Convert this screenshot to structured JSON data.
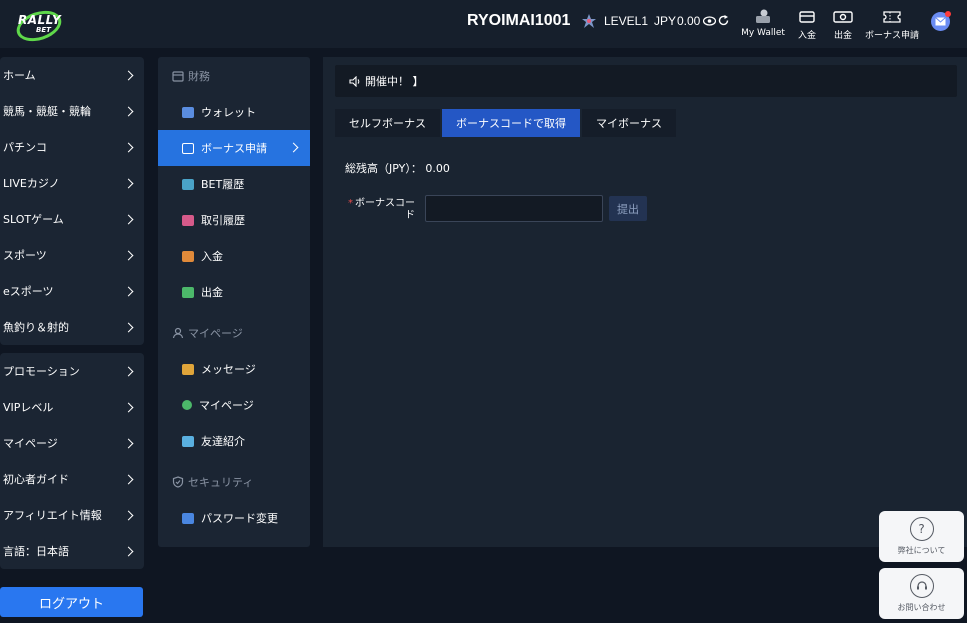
{
  "header": {
    "username": "RYOIMAI1001",
    "level": "LEVEL1",
    "balance_currency": "JPY",
    "balance_value": "0.00",
    "buttons": [
      {
        "label": "My Wallet",
        "icon": "wallet-icon"
      },
      {
        "label": "入金",
        "icon": "deposit-card-icon"
      },
      {
        "label": "出金",
        "icon": "withdraw-cash-icon"
      },
      {
        "label": "ボーナス申請",
        "icon": "ticket-icon"
      }
    ]
  },
  "sidebar": {
    "group1": [
      "ホーム",
      "競馬・競艇・競輪",
      "パチンコ",
      "LIVEカジノ",
      "SLOTゲーム",
      "スポーツ",
      "eスポーツ",
      "魚釣り＆射的"
    ],
    "group2": [
      "プロモーション",
      "VIPレベル",
      "マイページ",
      "初心者ガイド",
      "アフィリエイト情報",
      "言語：日本語"
    ],
    "logout": "ログアウト"
  },
  "menu2": {
    "finance_header": "財務",
    "finance_items": [
      "ウォレット",
      "ボーナス申請",
      "BET履歴",
      "取引履歴",
      "入金",
      "出金"
    ],
    "mypage_header": "マイページ",
    "mypage_items": [
      "メッセージ",
      "マイページ",
      "友達紹介"
    ],
    "security_header": "セキュリティ",
    "security_items": [
      "パスワード変更"
    ]
  },
  "content": {
    "notice": "開催中！ 】",
    "tabs": [
      "セルフボーナス",
      "ボーナスコードで取得",
      "マイボーナス"
    ],
    "active_tab": 1,
    "balance_label": "総残高（JPY）：",
    "balance_value": "0.00",
    "code_label": "ボーナスコード",
    "code_value": "",
    "submit": "提出"
  },
  "floating": {
    "about": "弊社について",
    "contact": "お問い合わせ"
  },
  "colors": {
    "accent": "#2673e0",
    "active_tab": "#2457c5",
    "logout": "#2977f0",
    "logo_ring": "#5fd84a"
  }
}
